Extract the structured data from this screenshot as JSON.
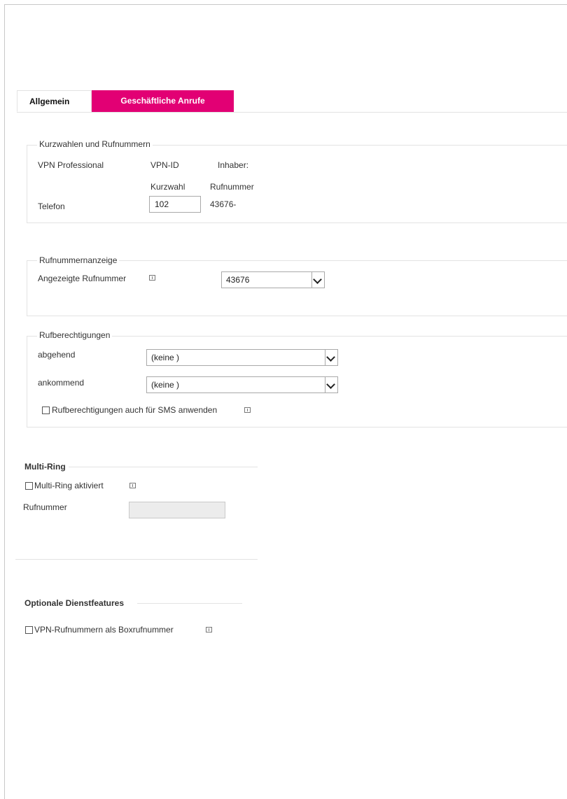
{
  "tabs": {
    "general": "Allgemein",
    "business_calls": "Geschäftliche Anrufe"
  },
  "shortcuts": {
    "legend": "Kurzwahlen und Rufnummern",
    "product": "VPN Professional",
    "vpn_id_label": "VPN-ID",
    "owner_label": "Inhaber:",
    "col_shortcut": "Kurzwahl",
    "col_number": "Rufnummer",
    "row_label": "Telefon",
    "shortcut_value": "102",
    "number_value": "43676-"
  },
  "display": {
    "legend": "Rufnummernanzeige",
    "label": "Angezeigte Rufnummer",
    "selected": "43676"
  },
  "permissions": {
    "legend": "Rufberechtigungen",
    "outgoing_label": "abgehend",
    "outgoing_value": "(keine )",
    "incoming_label": "ankommend",
    "incoming_value": "(keine )",
    "sms_checkbox": "Rufberechtigungen auch für SMS anwenden"
  },
  "multiring": {
    "heading": "Multi-Ring",
    "checkbox": "Multi-Ring aktiviert",
    "number_label": "Rufnummer"
  },
  "optional": {
    "heading": "Optionale Dienstfeatures",
    "checkbox": "VPN-Rufnummern als Boxrufnummer"
  },
  "colors": {
    "accent": "#e20074"
  }
}
